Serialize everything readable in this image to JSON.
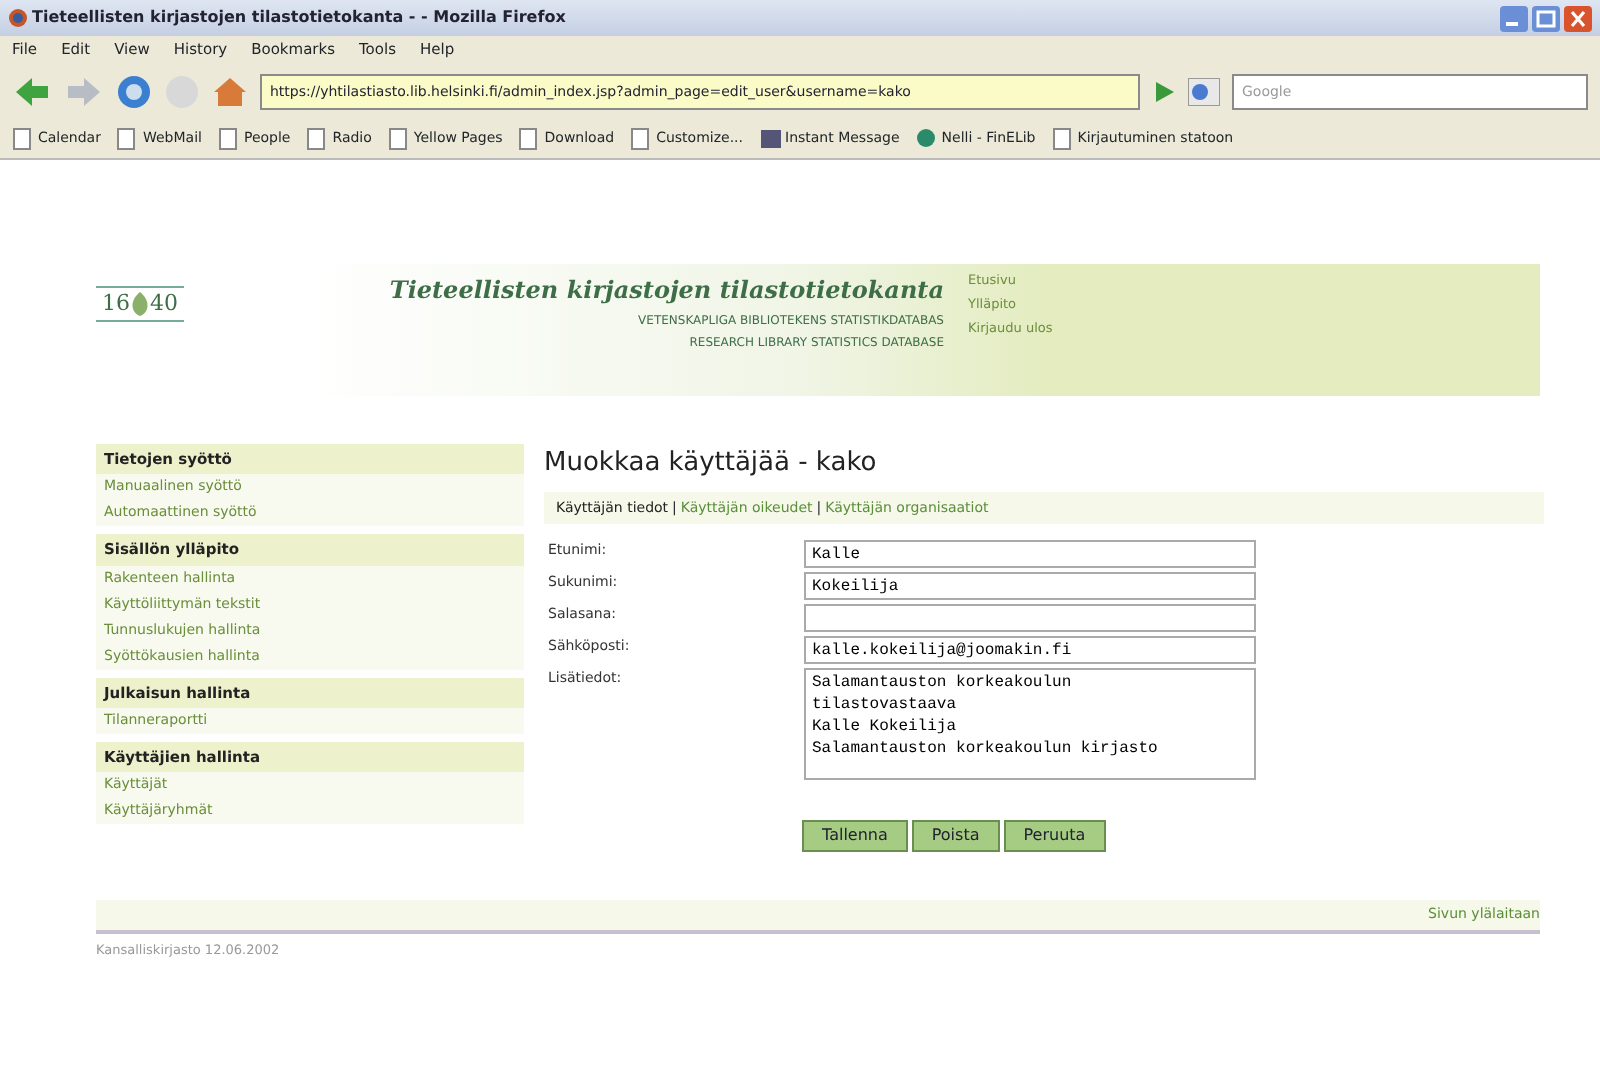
{
  "browser": {
    "title": "Tieteellisten kirjastojen tilastotietokanta - - Mozilla Firefox",
    "menu": [
      "File",
      "Edit",
      "View",
      "History",
      "Bookmarks",
      "Tools",
      "Help"
    ],
    "url": "https://yhtilastiasto.lib.helsinki.fi/admin_index.jsp?admin_page=edit_user&username=kako",
    "search_placeholder": "Google",
    "bookmarks": [
      {
        "label": "Calendar",
        "kind": "page"
      },
      {
        "label": "WebMail",
        "kind": "page"
      },
      {
        "label": "People",
        "kind": "page"
      },
      {
        "label": "Radio",
        "kind": "page"
      },
      {
        "label": "Yellow Pages",
        "kind": "page"
      },
      {
        "label": "Download",
        "kind": "page"
      },
      {
        "label": "Customize...",
        "kind": "page"
      },
      {
        "label": "Instant Message",
        "kind": "message"
      },
      {
        "label": "Nelli - FinELib",
        "kind": "site"
      },
      {
        "label": "Kirjautuminen statoon",
        "kind": "page"
      }
    ]
  },
  "site": {
    "logo": [
      "16",
      "40"
    ],
    "title": "Tieteellisten kirjastojen tilastotietokanta",
    "subtitles": [
      "VETENSKAPLIGA BIBLIOTEKENS STATISTIKDATABAS",
      "RESEARCH LIBRARY STATISTICS DATABASE"
    ],
    "top_links": [
      "Etusivu",
      "Ylläpito",
      "Kirjaudu ulos"
    ]
  },
  "sidebar": [
    {
      "heading": "Tietojen syöttö",
      "items": [
        "Manuaalinen syöttö",
        "Automaattinen syöttö"
      ]
    },
    {
      "heading": "Sisällön ylläpito",
      "items": [
        "Rakenteen hallinta",
        "Käyttöliittymän tekstit",
        "Tunnuslukujen hallinta",
        "Syöttökausien hallinta"
      ]
    },
    {
      "heading": "Julkaisun hallinta",
      "items": [
        "Tilanneraportti"
      ]
    },
    {
      "heading": "Käyttäjien hallinta",
      "items": [
        "Käyttäjät",
        "Käyttäjäryhmät"
      ]
    }
  ],
  "page_title": "Muokkaa käyttäjää - kako",
  "subtab_separators": [
    "|",
    "|"
  ],
  "subtabs": [
    {
      "label": "Käyttäjän tiedot",
      "selected": true
    },
    {
      "label": "Käyttäjän oikeudet",
      "selected": false
    },
    {
      "label": "Käyttäjän organisaatiot",
      "selected": false
    }
  ],
  "fields": [
    {
      "label": "Etunimi:",
      "kind": "input",
      "value": "Kalle"
    },
    {
      "label": "Sukunimi:",
      "kind": "input",
      "value": "Kokeilija"
    },
    {
      "label": "Salasana:",
      "kind": "input"
    },
    {
      "label": "Sähköposti:",
      "kind": "input",
      "value": "kalle.kokeilija@joomakin.fi"
    },
    {
      "label": "Lisätiedot:",
      "kind": "textarea",
      "value": "Salamantauston korkeakoulun\ntilastovastaava\nKalle Kokeilija\nSalamantauston korkeakoulun kirjasto"
    }
  ],
  "buttons": [
    "Tallenna",
    "Poista",
    "Peruuta"
  ],
  "footer_link": "Sivun ylälaitaan",
  "footer_note": "Kansalliskirjasto 12.06.2002"
}
